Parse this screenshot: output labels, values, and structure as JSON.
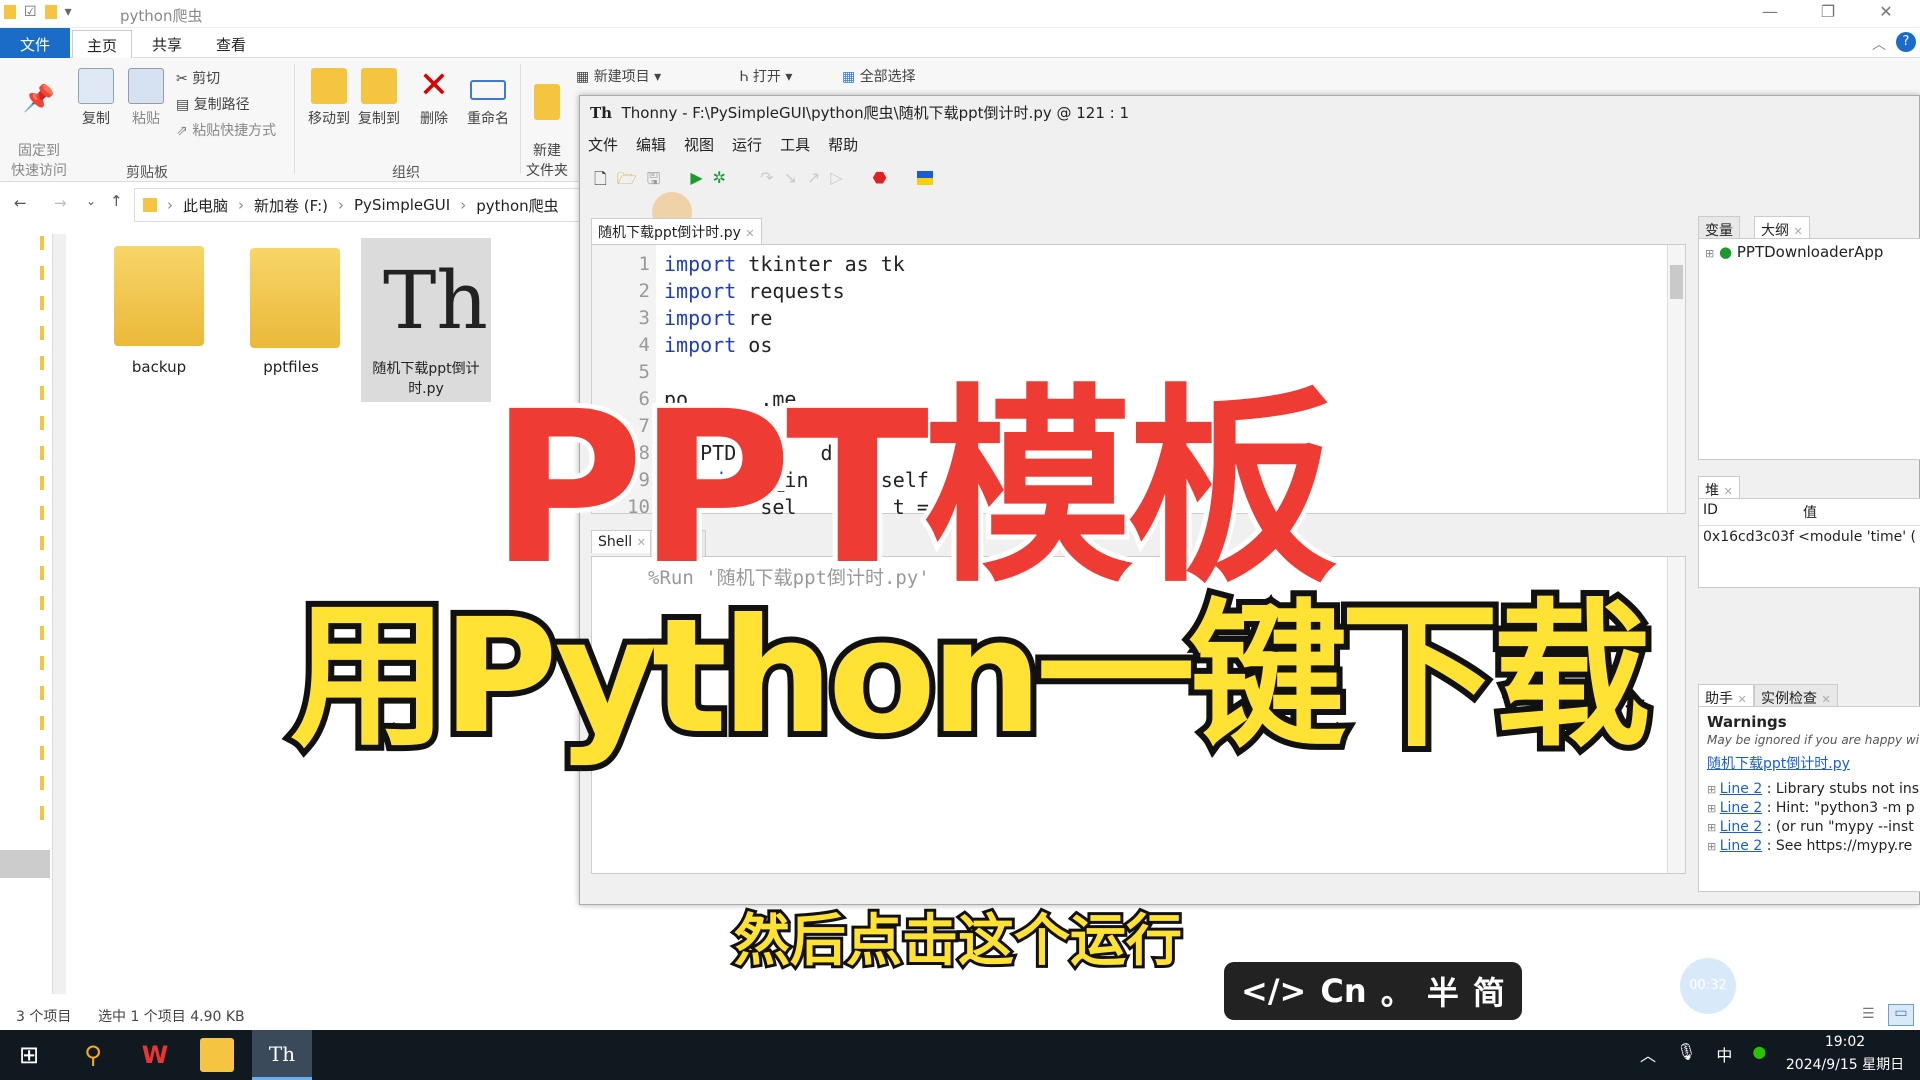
{
  "explorer": {
    "title": "python爬虫",
    "tabs": [
      "文件",
      "主页",
      "共享",
      "查看"
    ],
    "ribbon": {
      "pin": "固定到\n快速访问",
      "copy": "复制",
      "paste": "粘贴",
      "cut": "剪切",
      "copy_path": "复制路径",
      "paste_shortcut": "粘贴快捷方式",
      "clipboard_group": "剪贴板",
      "move_to": "移动到",
      "copy_to": "复制到",
      "delete": "删除",
      "rename": "重命名",
      "organize_group": "组织",
      "new_folder": "新建\n文件夹",
      "new_item": "新建项目",
      "open": "打开",
      "select_all": "全部选择"
    },
    "breadcrumb": [
      "此电脑",
      "新加卷 (F:)",
      "PySimpleGUI",
      "python爬虫"
    ],
    "files": [
      {
        "name": "backup"
      },
      {
        "name": "pptfiles"
      },
      {
        "name": "随机下载ppt倒计时.py"
      }
    ],
    "status": {
      "count": "3 个项目",
      "selected": "选中 1 个项目  4.90 KB"
    }
  },
  "thonny": {
    "title": "Thonny  -  F:\\PySimpleGUI\\python爬虫\\随机下载ppt倒计时.py  @  121 : 1",
    "menu": [
      "文件",
      "编辑",
      "视图",
      "运行",
      "工具",
      "帮助"
    ],
    "editor_tab": "随机下载ppt倒计时.py",
    "line_numbers": [
      "1",
      "2",
      "3",
      "4",
      "5",
      "6",
      "7",
      "8",
      "9",
      "10"
    ],
    "code": [
      {
        "kw": "import",
        "rest": " tkinter as tk"
      },
      {
        "kw": "import",
        "rest": " requests"
      },
      {
        "kw": "import",
        "rest": " re"
      },
      {
        "kw": "import",
        "rest": " os"
      },
      {
        "kw": "",
        "rest": ""
      },
      {
        "kw": "",
        "rest": "po      .me"
      },
      {
        "kw": "",
        "rest": ""
      },
      {
        "kw": "",
        "rest": "   PTDow     derA"
      },
      {
        "kw": "    def",
        "rest": " __in     (self"
      },
      {
        "kw": "",
        "rest": "        sel        t = r"
      }
    ],
    "shell_tabs": [
      "Shell",
      "异常"
    ],
    "shell_text": "%Run '随机下载ppt倒计时.py'",
    "vars_tabs": [
      "变量",
      "大纲"
    ],
    "outline_item": "PPTDownloaderApp",
    "heap_tab": "堆",
    "heap_headers": [
      "ID",
      "值"
    ],
    "heap_row": [
      "0x16cd3c03f",
      "<module 'time' ("
    ],
    "assistant_tabs": [
      "助手",
      "实例检查"
    ],
    "warnings_title": "Warnings",
    "warnings_note": "May be ignored if you are happy wit",
    "warnings_file": "随机下载ppt倒计时.py",
    "warnings": [
      {
        "link": "Line 2",
        "text": ": Library stubs not ins"
      },
      {
        "link": "Line 2",
        "text": ": Hint: \"python3 -m p"
      },
      {
        "link": "Line 2",
        "text": ": (or run \"mypy --inst"
      },
      {
        "link": "Line 2",
        "text": ": See https://mypy.re"
      }
    ]
  },
  "overlay": {
    "headline1": "PPT模板",
    "headline2": "用Python一键下载",
    "subtitle": "然后点击这个运行",
    "ime": [
      "</>",
      "Cn",
      "。",
      "半",
      "简"
    ],
    "timer": "00:32"
  },
  "taskbar": {
    "time": "19:02",
    "date": "2024/9/15 星期日",
    "ime_lang": "中"
  }
}
